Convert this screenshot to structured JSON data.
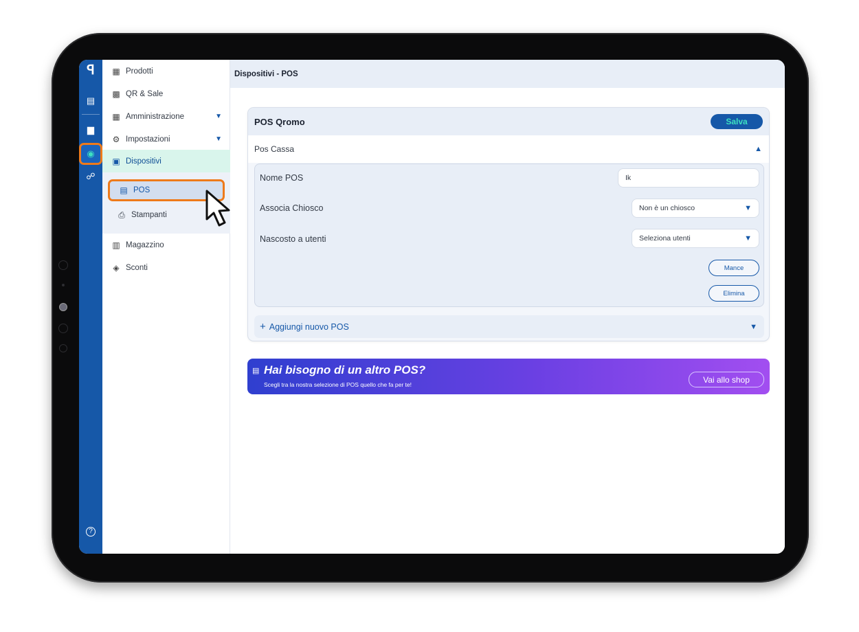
{
  "rail": {
    "logo": "ꟼ",
    "items": [
      {
        "icon": "receipt-icon",
        "glyph": "▤"
      },
      {
        "icon": "chart-icon",
        "glyph": "▆"
      },
      {
        "icon": "gear-icon",
        "glyph": "◉"
      },
      {
        "icon": "user-settings-icon",
        "glyph": "☍"
      }
    ],
    "help_glyph": "?"
  },
  "sidebar": {
    "items": [
      {
        "label": "Prodotti",
        "icon": "menu-card-icon",
        "glyph": "▦"
      },
      {
        "label": "QR & Sale",
        "icon": "qr-code-icon",
        "glyph": "▩"
      },
      {
        "label": "Amministrazione",
        "icon": "abacus-icon",
        "glyph": "▦"
      },
      {
        "label": "Impostazioni",
        "icon": "settings-box-icon",
        "glyph": "⚙"
      },
      {
        "label": "Dispositivi",
        "icon": "devices-icon",
        "glyph": "▣"
      },
      {
        "label": "Magazzino",
        "icon": "boxes-icon",
        "glyph": "▥"
      },
      {
        "label": "Sconti",
        "icon": "tag-icon",
        "glyph": "◈"
      }
    ],
    "sub_items": [
      {
        "label": "POS",
        "icon": "pos-icon",
        "glyph": "▤"
      },
      {
        "label": "Stampanti",
        "icon": "printer-icon",
        "glyph": "⎙"
      }
    ]
  },
  "header": {
    "title": "Dispositivi - POS"
  },
  "card": {
    "title": "POS Qromo",
    "save_label": "Salva",
    "section_title": "Pos Cassa",
    "fields": {
      "name_label": "Nome POS",
      "name_value": "Ik",
      "kiosk_label": "Associa Chiosco",
      "kiosk_value": "Non è un chiosco",
      "hidden_label": "Nascosto a utenti",
      "hidden_value": "Seleziona utenti"
    },
    "tips_label": "Mance",
    "delete_label": "Elimina",
    "add_label": "Aggiungi nuovo POS"
  },
  "banner": {
    "title": "Hai bisogno di un altro POS?",
    "subtitle": "Scegli tra la nostra selezione di POS quello che fa per te!",
    "button_label": "Vai allo shop"
  },
  "colors": {
    "brand_blue": "#1658a8",
    "accent_teal": "#3de0c1",
    "highlight_orange": "#ee7a1a"
  }
}
